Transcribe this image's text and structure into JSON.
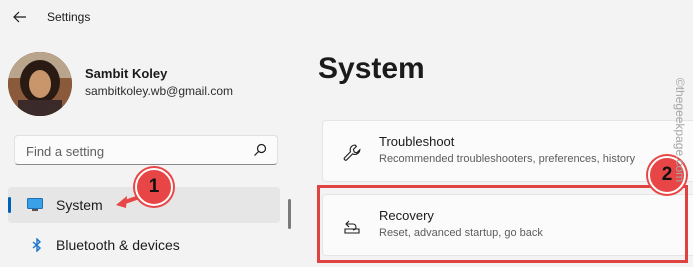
{
  "app": {
    "title": "Settings"
  },
  "user": {
    "name": "Sambit Koley",
    "email": "sambitkoley.wb@gmail.com"
  },
  "search": {
    "placeholder": "Find a setting"
  },
  "nav": {
    "items": [
      {
        "label": "System",
        "icon": "monitor-icon",
        "selected": true
      },
      {
        "label": "Bluetooth & devices",
        "icon": "bluetooth-icon",
        "selected": false
      }
    ]
  },
  "page": {
    "title": "System"
  },
  "cards": [
    {
      "title": "Troubleshoot",
      "description": "Recommended troubleshooters, preferences, history",
      "icon": "wrench-icon"
    },
    {
      "title": "Recovery",
      "description": "Reset, advanced startup, go back",
      "icon": "recovery-icon"
    }
  ],
  "annotations": {
    "marker1": "1",
    "marker2": "2"
  },
  "watermark": "©thegeekpage.com",
  "colors": {
    "accent": "#005fb8",
    "highlight": "#e04141"
  }
}
